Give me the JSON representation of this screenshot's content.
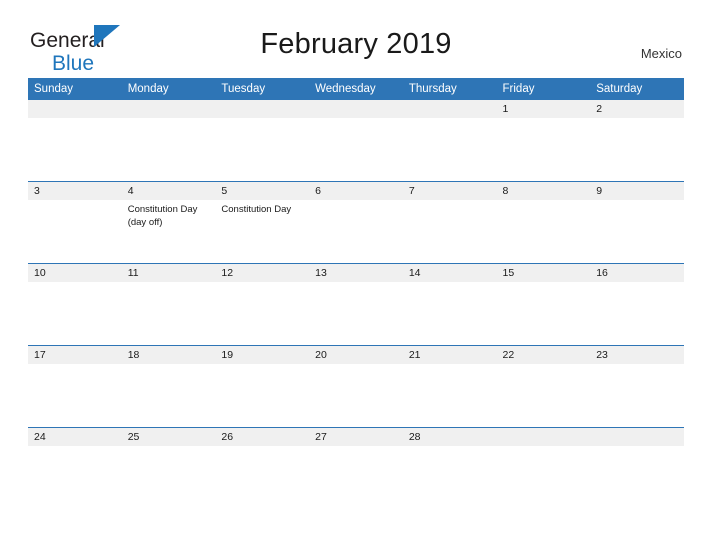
{
  "brand": {
    "name_part1": "General",
    "name_part2": "Blue",
    "flag_icon": "blue-triangle-flag",
    "color_dark": "#231f20",
    "color_blue": "#1f76bc"
  },
  "header": {
    "title": "February 2019",
    "country": "Mexico"
  },
  "calendar": {
    "accent_color": "#2e75b6",
    "daynum_band_color": "#f0f0f0",
    "weekday_headers": [
      "Sunday",
      "Monday",
      "Tuesday",
      "Wednesday",
      "Thursday",
      "Friday",
      "Saturday"
    ],
    "weeks": [
      [
        {
          "day": "",
          "events": []
        },
        {
          "day": "",
          "events": []
        },
        {
          "day": "",
          "events": []
        },
        {
          "day": "",
          "events": []
        },
        {
          "day": "",
          "events": []
        },
        {
          "day": "1",
          "events": []
        },
        {
          "day": "2",
          "events": []
        }
      ],
      [
        {
          "day": "3",
          "events": []
        },
        {
          "day": "4",
          "events": [
            "Constitution Day",
            "(day off)"
          ]
        },
        {
          "day": "5",
          "events": [
            "Constitution Day"
          ]
        },
        {
          "day": "6",
          "events": []
        },
        {
          "day": "7",
          "events": []
        },
        {
          "day": "8",
          "events": []
        },
        {
          "day": "9",
          "events": []
        }
      ],
      [
        {
          "day": "10",
          "events": []
        },
        {
          "day": "11",
          "events": []
        },
        {
          "day": "12",
          "events": []
        },
        {
          "day": "13",
          "events": []
        },
        {
          "day": "14",
          "events": []
        },
        {
          "day": "15",
          "events": []
        },
        {
          "day": "16",
          "events": []
        }
      ],
      [
        {
          "day": "17",
          "events": []
        },
        {
          "day": "18",
          "events": []
        },
        {
          "day": "19",
          "events": []
        },
        {
          "day": "20",
          "events": []
        },
        {
          "day": "21",
          "events": []
        },
        {
          "day": "22",
          "events": []
        },
        {
          "day": "23",
          "events": []
        }
      ],
      [
        {
          "day": "24",
          "events": []
        },
        {
          "day": "25",
          "events": []
        },
        {
          "day": "26",
          "events": []
        },
        {
          "day": "27",
          "events": []
        },
        {
          "day": "28",
          "events": []
        },
        {
          "day": "",
          "events": []
        },
        {
          "day": "",
          "events": []
        }
      ]
    ]
  }
}
